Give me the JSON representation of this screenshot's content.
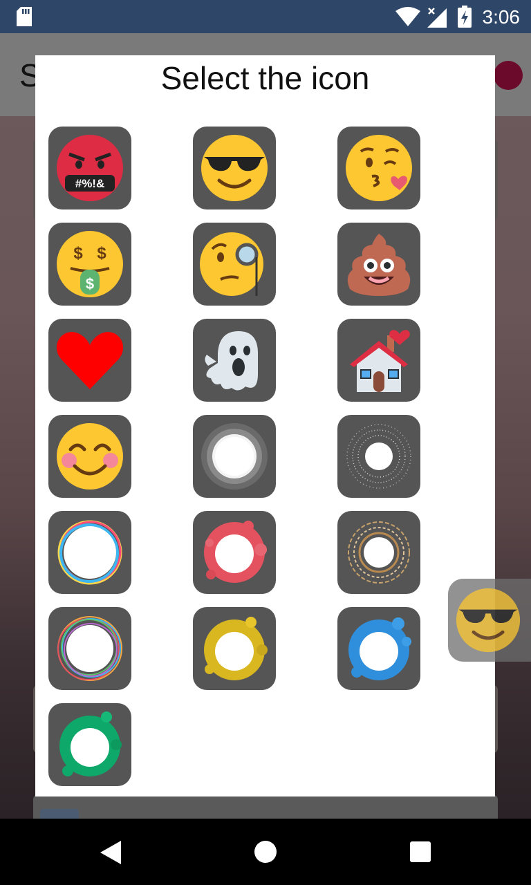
{
  "status_bar": {
    "time": "3:06"
  },
  "background": {
    "title_initial": "S"
  },
  "dialog": {
    "title": "Select the icon",
    "icons": [
      {
        "name": "angry-swearing-face-icon",
        "label": "#%!&"
      },
      {
        "name": "sunglasses-face-icon"
      },
      {
        "name": "kissing-face-icon"
      },
      {
        "name": "money-mouth-face-icon",
        "label": "$"
      },
      {
        "name": "monocle-face-icon"
      },
      {
        "name": "poop-icon"
      },
      {
        "name": "red-heart-icon"
      },
      {
        "name": "ghost-icon"
      },
      {
        "name": "house-with-heart-icon"
      },
      {
        "name": "smiling-blushing-face-icon"
      },
      {
        "name": "gray-ring-circle-icon"
      },
      {
        "name": "dotted-ring-circle-icon"
      },
      {
        "name": "rainbow-ring-circle-icon"
      },
      {
        "name": "red-splash-circle-icon"
      },
      {
        "name": "gold-dashed-ring-circle-icon"
      },
      {
        "name": "multicolor-scribble-circle-icon"
      },
      {
        "name": "yellow-splash-circle-icon"
      },
      {
        "name": "blue-splash-circle-icon"
      },
      {
        "name": "green-splash-circle-icon"
      }
    ]
  },
  "floating_icon": {
    "name": "sunglasses-face-icon"
  },
  "nav": {
    "back": "back-icon",
    "home": "home-icon",
    "recents": "recents-icon"
  }
}
